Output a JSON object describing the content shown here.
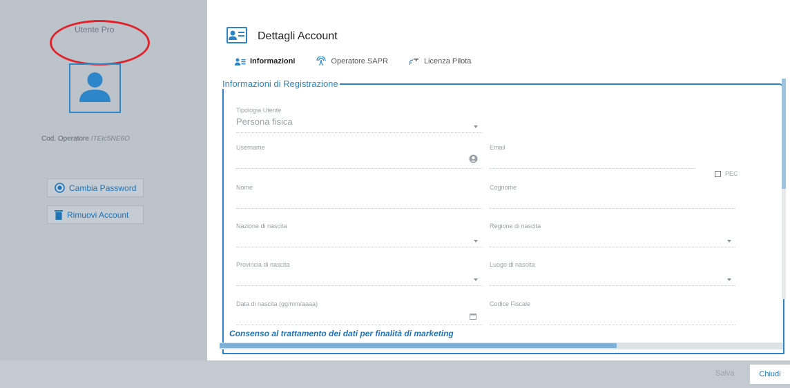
{
  "sidebar": {
    "user_type": "Utente Pro",
    "operator_code_label": "Cod. Operatore",
    "operator_code_value": "ITEIc5NE6O",
    "change_password_label": "Cambia Password",
    "remove_account_label": "Rimuovi Account"
  },
  "header": {
    "title": "Dettagli Account",
    "tabs": [
      {
        "label": "Informazioni",
        "icon": "user-list-icon",
        "active": true
      },
      {
        "label": "Operatore SAPR",
        "icon": "antenna-icon",
        "active": false
      },
      {
        "label": "Licenza Pilota",
        "icon": "drone-signal-icon",
        "active": false
      }
    ]
  },
  "form": {
    "section_title": "Informazioni di Registrazione",
    "user_type_label": "Tipologia Utente",
    "user_type_value": "Persona fisica",
    "username_label": "Username",
    "email_label": "Email",
    "pec_label": "PEC",
    "nome_label": "Nome",
    "cognome_label": "Cognome",
    "nazione_label": "Nazione di nascita",
    "regione_label": "Regione di nascita",
    "provincia_label": "Provincia di nascita",
    "luogo_label": "Luogo di nascita",
    "data_label": "Data di nascita (gg/mm/aaaa)",
    "codice_fiscale_label": "Codice Fiscale",
    "marketing_title": "Consenso al trattamento dei dati per finalità di marketing"
  },
  "footer": {
    "save_label": "Salva",
    "close_label": "Chiudi"
  },
  "colors": {
    "accent": "#2a85c6",
    "highlight": "#e0232a"
  }
}
